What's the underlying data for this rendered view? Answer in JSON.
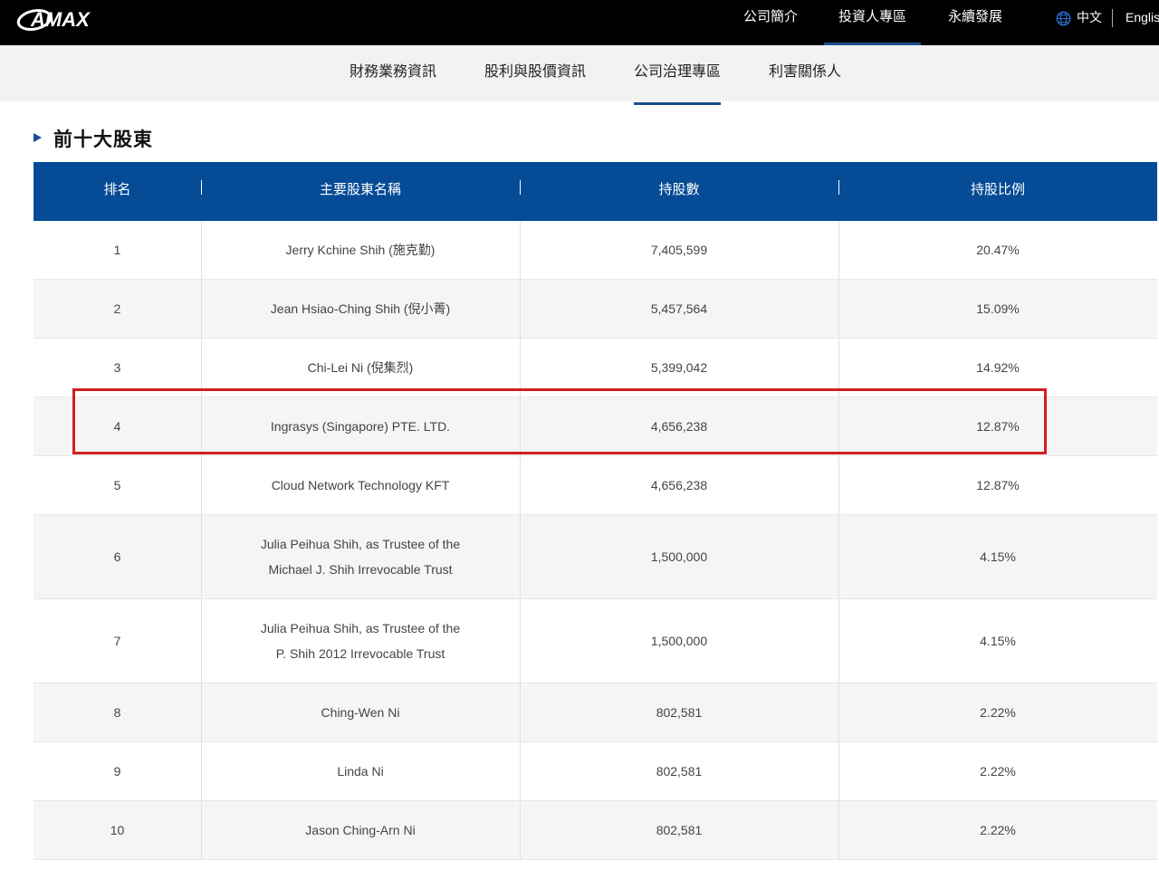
{
  "header": {
    "logo_text": "AMAX",
    "nav": [
      "公司簡介",
      "投資人專區",
      "永續發展"
    ],
    "lang_zh": "中文",
    "lang_en": "English",
    "globe_icon": "globe-icon"
  },
  "subnav": [
    "財務業務資訊",
    "股利與股價資訊",
    "公司治理專區",
    "利害關係人"
  ],
  "section": {
    "title": "前十大股東"
  },
  "table": {
    "headers": [
      "排名",
      "主要股東名稱",
      "持股數",
      "持股比例"
    ],
    "rows": [
      {
        "rank": "1",
        "name": [
          "Jerry Kchine Shih (施克勤)"
        ],
        "shares": "7,405,599",
        "ratio": "20.47%"
      },
      {
        "rank": "2",
        "name": [
          "Jean Hsiao-Ching Shih (倪小菁)"
        ],
        "shares": "5,457,564",
        "ratio": "15.09%"
      },
      {
        "rank": "3",
        "name": [
          "Chi-Lei Ni (倪集烈)"
        ],
        "shares": "5,399,042",
        "ratio": "14.92%"
      },
      {
        "rank": "4",
        "name": [
          "Ingrasys (Singapore) PTE. LTD."
        ],
        "shares": "4,656,238",
        "ratio": "12.87%"
      },
      {
        "rank": "5",
        "name": [
          "Cloud Network Technology KFT"
        ],
        "shares": "4,656,238",
        "ratio": "12.87%"
      },
      {
        "rank": "6",
        "name": [
          "Julia Peihua Shih, as Trustee of the",
          "Michael J. Shih Irrevocable Trust"
        ],
        "shares": "1,500,000",
        "ratio": "4.15%"
      },
      {
        "rank": "7",
        "name": [
          "Julia Peihua Shih, as Trustee of the",
          "P. Shih 2012 Irrevocable Trust"
        ],
        "shares": "1,500,000",
        "ratio": "4.15%"
      },
      {
        "rank": "8",
        "name": [
          "Ching-Wen Ni"
        ],
        "shares": "802,581",
        "ratio": "2.22%"
      },
      {
        "rank": "9",
        "name": [
          "Linda Ni"
        ],
        "shares": "802,581",
        "ratio": "2.22%"
      },
      {
        "rank": "10",
        "name": [
          "Jason Ching-Arn Ni"
        ],
        "shares": "802,581",
        "ratio": "2.22%"
      }
    ]
  },
  "colors": {
    "header_bg": "#000000",
    "table_header": "#054b96",
    "accent": "#1c4c8e",
    "highlight": "#d11f24"
  }
}
